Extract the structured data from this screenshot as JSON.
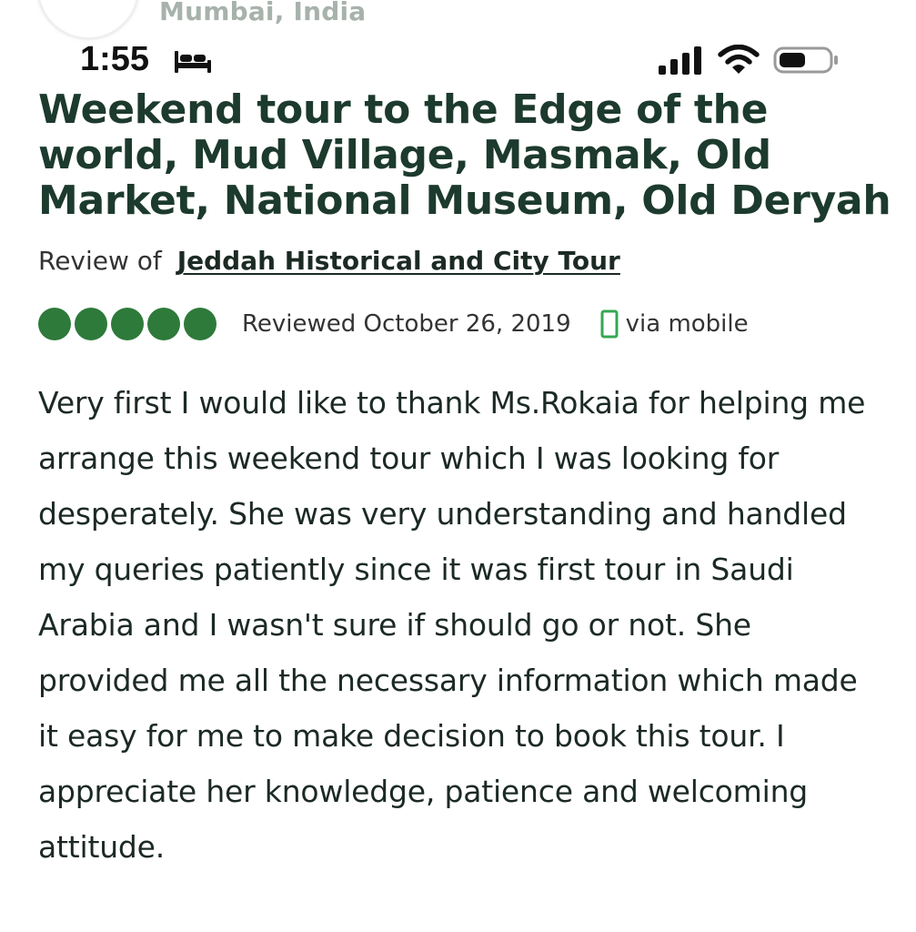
{
  "profile": {
    "location": "Mumbai, India"
  },
  "status_bar": {
    "time": "1:55",
    "icons": [
      "sleep-bed-icon",
      "cellular-signal-icon",
      "wifi-icon",
      "battery-icon"
    ]
  },
  "review": {
    "title": "Weekend tour to the Edge of the world, Mud Village, Masmak, Old Market, National Museum, Old Deryah",
    "review_of_prefix": "Review of",
    "attraction_link": "Jeddah Historical and City Tour",
    "rating": 5,
    "rating_max": 5,
    "reviewed_date": "Reviewed October 26, 2019",
    "via_mobile": "via mobile",
    "body": "Very first I would like to thank Ms.Rokaia for helping me arrange this weekend tour which I was looking for desperately. She was very understanding and handled my queries patiently since it was first tour in Saudi Arabia and I wasn't sure if should go or not. She provided me all the necessary information which made it easy for me to make decision to book this tour. I appreciate her knowledge, patience and welcoming attitude."
  },
  "colors": {
    "bubble": "#2d7a3a",
    "title": "#1c3a2d",
    "mobile_icon": "#34a853"
  }
}
